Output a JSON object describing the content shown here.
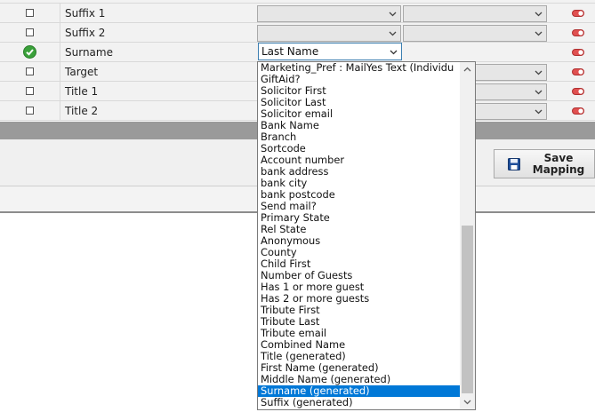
{
  "rows": [
    {
      "checked": false,
      "name": "Suffix 1",
      "toggle": "on"
    },
    {
      "checked": false,
      "name": "Suffix 2",
      "toggle": "on"
    },
    {
      "checked": true,
      "name": "Surname",
      "selected_field": "Last Name",
      "toggle": "on"
    },
    {
      "checked": false,
      "name": "Target",
      "toggle": "on"
    },
    {
      "checked": false,
      "name": "Title 1",
      "toggle": "on"
    },
    {
      "checked": false,
      "name": "Title 2",
      "toggle": "on"
    }
  ],
  "save_button": {
    "label_line1": "Save",
    "label_line2": "Mapping"
  },
  "dropdown": {
    "options": [
      "Marketing_Pref : MailYes Text (Individu",
      "GiftAid?",
      "Solicitor First",
      "Solicitor Last",
      "Solicitor email",
      "Bank Name",
      "Branch",
      "Sortcode",
      "Account number",
      "bank address",
      "bank city",
      "bank postcode",
      "Send mail?",
      "Primary State",
      "Rel State",
      "Anonymous",
      "County",
      "Child First",
      "Number of Guests",
      "Has 1 or more guest",
      "Has 2 or more guests",
      "Tribute First",
      "Tribute Last",
      "Tribute email",
      "Combined Name",
      "Title (generated)",
      "First Name (generated)",
      "Middle Name (generated)",
      "Surname (generated)",
      "Suffix (generated)"
    ],
    "highlighted": "Surname (generated)"
  },
  "colors": {
    "highlight": "#0078d7",
    "toggle": "#e05050",
    "check": "#3aa13a"
  },
  "icons": {
    "checkmark": "check-circle-icon",
    "toggle": "toggle-icon",
    "save": "floppy-disk-icon",
    "chevron": "chevron-down-icon"
  }
}
